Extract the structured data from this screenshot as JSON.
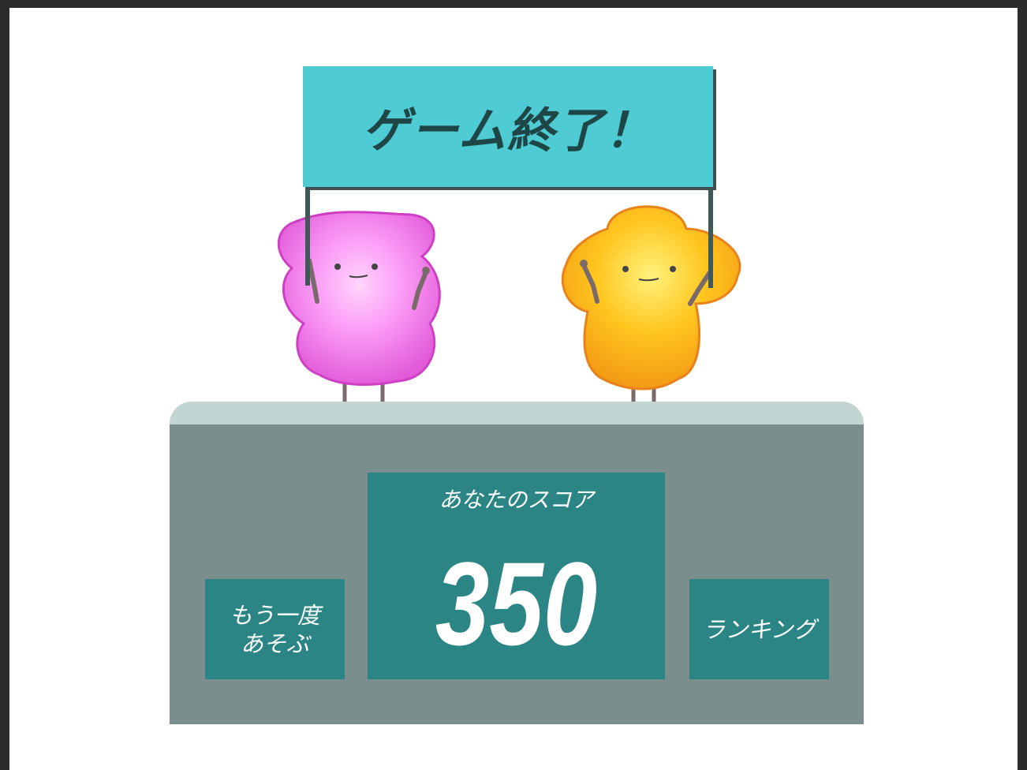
{
  "banner": {
    "title": "ゲーム終了！"
  },
  "score": {
    "label": "あなたのスコア",
    "value": "350"
  },
  "buttons": {
    "replay_line1": "もう一度",
    "replay_line2": "あそぶ",
    "ranking": "ランキング"
  },
  "colors": {
    "banner": "#4ecbd3",
    "podium": "#7a8e8e",
    "panel": "#2b8585",
    "pink_character": "#f07df0",
    "yellow_character": "#ffc21a"
  }
}
